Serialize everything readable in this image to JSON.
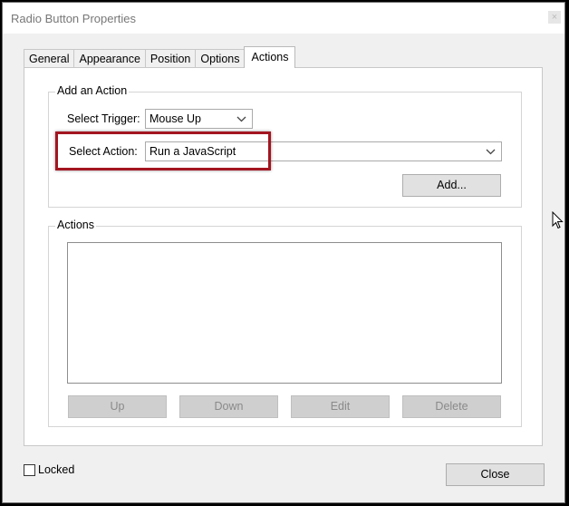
{
  "window": {
    "title": "Radio Button Properties",
    "close_glyph": "×"
  },
  "tabs": [
    {
      "label": "General"
    },
    {
      "label": "Appearance"
    },
    {
      "label": "Position"
    },
    {
      "label": "Options"
    },
    {
      "label": "Actions",
      "active": true
    }
  ],
  "add_action": {
    "legend": "Add an Action",
    "trigger_label": "Select Trigger:",
    "trigger_value": "Mouse Up",
    "action_label": "Select Action:",
    "action_value": "Run a JavaScript",
    "add_button": "Add..."
  },
  "actions": {
    "legend": "Actions",
    "items": [],
    "buttons": {
      "up": "Up",
      "down": "Down",
      "edit": "Edit",
      "delete": "Delete"
    }
  },
  "footer": {
    "locked_label": "Locked",
    "locked_checked": false,
    "close_button": "Close"
  },
  "colors": {
    "highlight": "#a31520"
  }
}
